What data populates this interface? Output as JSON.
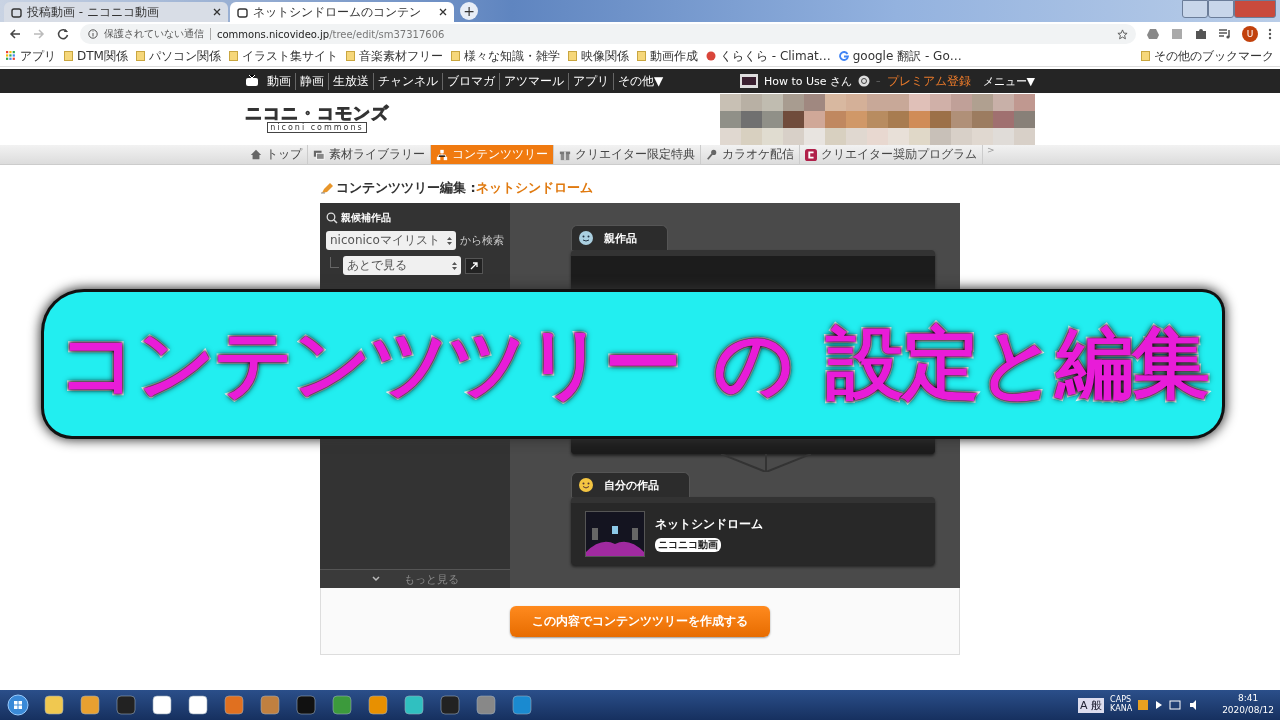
{
  "browser": {
    "tabs": [
      {
        "title": "投稿動画 - ニコニコ動画",
        "selected": false
      },
      {
        "title": "ネットシンドロームのコンテン",
        "selected": true
      }
    ],
    "new_tab": "+",
    "address": {
      "security": "保護されていない通信",
      "url_host": "commons.nicovideo.jp",
      "url_path": "/tree/edit/sm37317606"
    },
    "profile_initial": "U",
    "bookmarks": [
      {
        "label": "アプリ",
        "kind": "apps"
      },
      {
        "label": "DTM関係",
        "kind": "folder"
      },
      {
        "label": "パソコン関係",
        "kind": "folder"
      },
      {
        "label": "イラスト集サイト",
        "kind": "folder"
      },
      {
        "label": "音楽素材フリー",
        "kind": "folder"
      },
      {
        "label": "様々な知識・雑学",
        "kind": "folder"
      },
      {
        "label": "映像関係",
        "kind": "folder"
      },
      {
        "label": "動画作成",
        "kind": "folder"
      },
      {
        "label": "くらくら - Climat…",
        "kind": "site"
      },
      {
        "label": "google 翻訳 - Go…",
        "kind": "google"
      }
    ],
    "other_bookmarks": "その他のブックマーク"
  },
  "site_bar": {
    "links": [
      "動画",
      "静画",
      "生放送",
      "チャンネル",
      "ブロマガ",
      "アツマール",
      "アプリ",
      "その他▼"
    ],
    "user": "How to Use さん",
    "dash": "–",
    "premium": "プレミアム登録",
    "menu": "メニュー▼"
  },
  "logo": {
    "main": "ニコニ・コモンズ",
    "sub": "niconi commons"
  },
  "nav": [
    {
      "label": "トップ",
      "selected": false
    },
    {
      "label": "素材ライブラリー",
      "selected": false
    },
    {
      "label": "コンテンツツリー",
      "selected": true
    },
    {
      "label": "クリエイター限定特典",
      "selected": false
    },
    {
      "label": "カラオケ配信",
      "selected": false
    },
    {
      "label": "クリエイター奨励プログラム",
      "selected": false
    }
  ],
  "nav_more": ">",
  "page_title": {
    "prefix": "コンテンツツリー編集 :",
    "work": "ネットシンドローム"
  },
  "candidates": {
    "title": "親候補作品",
    "source": "niconicoマイリスト",
    "source_suffix": "から検索",
    "list": "あとで見る",
    "more": "もっと見る"
  },
  "tree": {
    "parent_title": "親作品",
    "own_title": "自分の作品",
    "own_work": {
      "title": "ネットシンドローム",
      "badge": "ニコニコ動画"
    }
  },
  "submit": "この内容でコンテンツツリーを作成する",
  "caption": [
    "コンテンツツリー",
    "の",
    "設定と編集"
  ],
  "tray": {
    "ime": "A 般",
    "caps": "CAPS",
    "kana": "KANA",
    "time": "8:41",
    "date": "2020/08/12"
  }
}
